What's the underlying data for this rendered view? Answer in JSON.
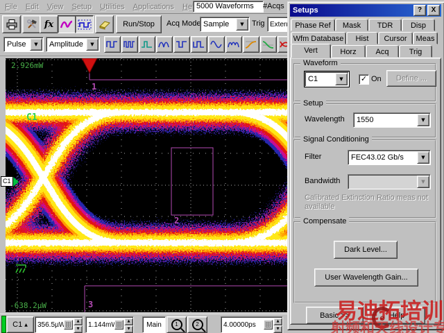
{
  "menu": {
    "items": [
      "File",
      "Edit",
      "View",
      "Setup",
      "Utilities",
      "Applications",
      "Help"
    ],
    "acq_counter": "5000 Waveforms",
    "acqs_label": "#Acqs"
  },
  "toolbar": {
    "icons": [
      "printer-icon",
      "calibrate-tools-icon",
      "function-icon",
      "color-grade-waveform-icon",
      "waveform-marquee-icon",
      "clear-display-eraser-icon"
    ],
    "fx_label": "fx",
    "run_stop_label": "Run/Stop",
    "acq_mode_label": "Acq Mode",
    "acq_mode_value": "Sample",
    "trig_label": "Trig",
    "trig_value": "External Dir"
  },
  "measure_bar": {
    "mode_value": "Pulse",
    "category_value": "Amplitude",
    "icons": [
      "square-wave-1-icon",
      "square-wave-2-icon",
      "pulse-icon",
      "round-wave-1-icon",
      "square-wave-3-icon",
      "square-wave-4-icon",
      "sine-wave-icon",
      "round-wave-2-icon",
      "rise-edge-icon",
      "fall-edge-icon",
      "eye-diagram-1-icon",
      "eye-diagram-2-icon"
    ]
  },
  "scope": {
    "top_scale_value": "2.926mW",
    "bottom_scale_value": "-638.2µW",
    "trace_label": "C1",
    "channel_marker_label": "C1",
    "mask_region_1": "1",
    "mask_region_2": "2",
    "mask_region_3": "3"
  },
  "status_bar": {
    "channel_button": "C1",
    "scale_value": "356.5µW/",
    "offset_value": "1.144mW",
    "timebase_label": "Main",
    "zoom1_label": "1",
    "zoom2_label": "2",
    "delay_value": "4.00000ps"
  },
  "setups_dialog": {
    "title": "Setups",
    "help_button": "?",
    "close_button": "X",
    "tab_rows": [
      [
        "Phase Ref",
        "Mask",
        "TDR",
        "Disp"
      ],
      [
        "Wfm Database",
        "Hist",
        "Cursor",
        "Meas"
      ],
      [
        "Vert",
        "Horz",
        "Acq",
        "Trig"
      ]
    ],
    "active_tab": "Vert",
    "waveform_group": {
      "legend": "Waveform",
      "source_value": "C1",
      "on_label": "On",
      "define_button": "Define ..."
    },
    "setup_group": {
      "legend": "Setup",
      "wavelength_label": "Wavelength",
      "wavelength_value": "1550"
    },
    "signal_conditioning_group": {
      "legend": "Signal Conditioning",
      "filter_label": "Filter",
      "filter_value": "FEC43.02 Gb/s",
      "bandwidth_label": "Bandwidth",
      "bandwidth_value": "",
      "note": "Calibrated Extinction Ratio meas not available"
    },
    "compensate_group": {
      "legend": "Compensate",
      "dark_level_button": "Dark Level...",
      "user_gain_button": "User Wavelength Gain..."
    },
    "basic_button": "Basic >>",
    "help_button_label": "Help"
  },
  "watermark": {
    "title": "易迪拓培训",
    "logo_letter": "e",
    "subtitle": "射频和天线设计专家"
  },
  "icons": {
    "combo_arrow": "▼",
    "spin_up": "▲",
    "spin_down": "▼",
    "check": "✓",
    "channel_up_arrow": "▲"
  },
  "colors": {
    "titlebar_blue": "#0a0a8c",
    "scope_background": "#000000",
    "mask_purple": "#b44ab4",
    "trigger_red": "#d01010",
    "trace_green": "#2ed058",
    "watermark_red": "#c91c1c"
  }
}
